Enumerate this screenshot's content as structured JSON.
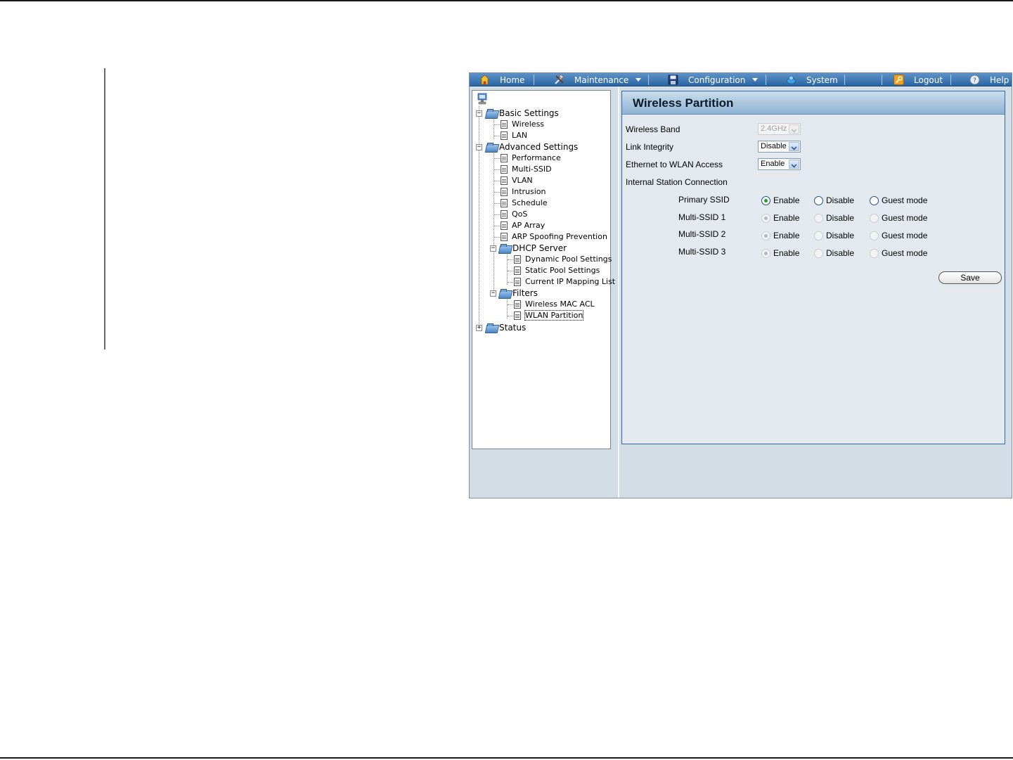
{
  "menu": {
    "home": "Home",
    "maintenance": "Maintenance",
    "configuration": "Configuration",
    "system": "System",
    "logout": "Logout",
    "help": "Help"
  },
  "tree": {
    "basic_settings": "Basic Settings",
    "wireless": "Wireless",
    "lan": "LAN",
    "advanced_settings": "Advanced Settings",
    "performance": "Performance",
    "multi_ssid": "Multi-SSID",
    "vlan": "VLAN",
    "intrusion": "Intrusion",
    "schedule": "Schedule",
    "qos": "QoS",
    "ap_array": "AP Array",
    "arp_spoofing": "ARP Spoofing Prevention",
    "dhcp_server": "DHCP Server",
    "dynamic_pool": "Dynamic Pool Settings",
    "static_pool": "Static Pool Settings",
    "current_ip": "Current IP Mapping List",
    "filters": "Filters",
    "wireless_mac_acl": "Wireless MAC ACL",
    "wlan_partition": "WLAN Partition",
    "status": "Status"
  },
  "panel": {
    "title": "Wireless Partition",
    "wireless_band": {
      "label": "Wireless Band",
      "value": "2.4GHz"
    },
    "link_integrity": {
      "label": "Link Integrity",
      "value": "Disable"
    },
    "ethernet_to_wlan": {
      "label": "Ethernet to WLAN Access",
      "value": "Enable"
    },
    "internal_station": {
      "label": "Internal Station Connection"
    },
    "option_enable": "Enable",
    "option_disable": "Disable",
    "option_guest": "Guest mode",
    "rows": [
      {
        "label": "Primary SSID",
        "selected": "Enable",
        "enabled": true
      },
      {
        "label": "Multi-SSID 1",
        "selected": "Enable",
        "enabled": false
      },
      {
        "label": "Multi-SSID 2",
        "selected": "Enable",
        "enabled": false
      },
      {
        "label": "Multi-SSID 3",
        "selected": "Enable",
        "enabled": false
      }
    ],
    "save": "Save"
  }
}
